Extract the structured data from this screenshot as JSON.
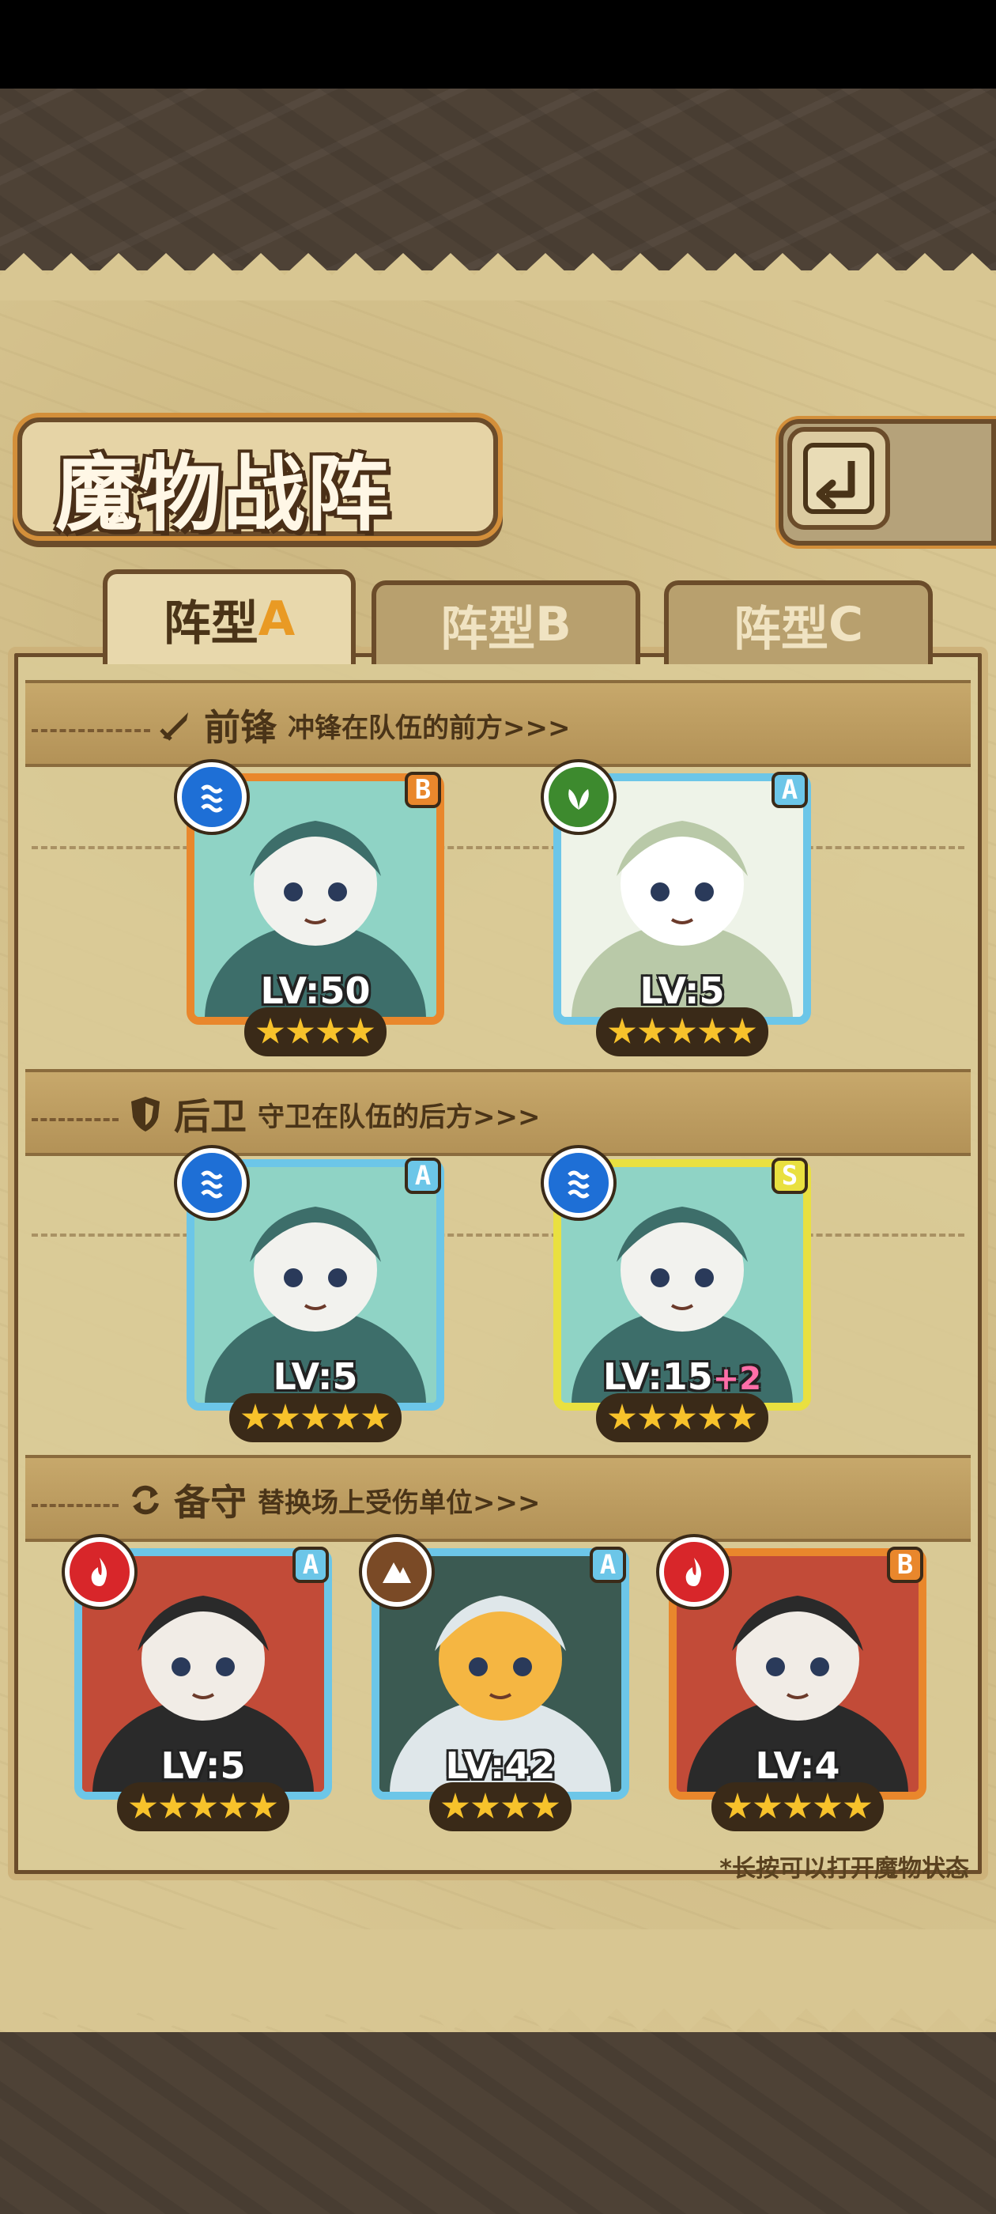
{
  "screen": {
    "title": "魔物战阵",
    "back_icon": "return-arrow-icon"
  },
  "tabs": [
    {
      "label": "阵型",
      "letter": "A",
      "active": true
    },
    {
      "label": "阵型",
      "letter": "B",
      "active": false
    },
    {
      "label": "阵型",
      "letter": "C",
      "active": false
    }
  ],
  "sections": {
    "vanguard": {
      "icon": "sword-icon",
      "title": "前锋",
      "subtitle": "冲锋在队伍的前方>>>"
    },
    "rearguard": {
      "icon": "shield-icon",
      "title": "后卫",
      "subtitle": "守卫在队伍的后方>>>"
    },
    "reserve": {
      "icon": "swap-icon",
      "title": "备守",
      "subtitle": "替换场上受伤单位>>>"
    }
  },
  "units": {
    "vanguard": [
      {
        "element": "water",
        "rarity": "B",
        "level": "LV:50",
        "bonus": "",
        "stars": 4,
        "frame_color": "#e9872c"
      },
      {
        "element": "nature",
        "rarity": "A",
        "level": "LV:5",
        "bonus": "",
        "stars": 5,
        "frame_color": "#6cc6e8"
      }
    ],
    "rearguard": [
      {
        "element": "water",
        "rarity": "A",
        "level": "LV:5",
        "bonus": "",
        "stars": 5,
        "frame_color": "#6cc6e8"
      },
      {
        "element": "water",
        "rarity": "S",
        "level": "LV:15",
        "bonus": "+2",
        "stars": 5,
        "frame_color": "#e9e040"
      }
    ],
    "reserve": [
      {
        "element": "fire",
        "rarity": "A",
        "level": "LV:5",
        "bonus": "",
        "stars": 5,
        "frame_color": "#6cc6e8"
      },
      {
        "element": "earth",
        "rarity": "A",
        "level": "LV:42",
        "bonus": "",
        "stars": 4,
        "frame_color": "#6cc6e8"
      },
      {
        "element": "fire",
        "rarity": "B",
        "level": "LV:4",
        "bonus": "",
        "stars": 5,
        "frame_color": "#e9872c"
      }
    ]
  },
  "hint": "*长按可以打开魔物状态",
  "colors": {
    "water": "#1e6fd6",
    "nature": "#3d8a2e",
    "fire": "#d8262a",
    "earth": "#7a4a26",
    "rarity_A": "#6cc6e8",
    "rarity_B": "#e9872c",
    "rarity_S": "#e9e040"
  }
}
